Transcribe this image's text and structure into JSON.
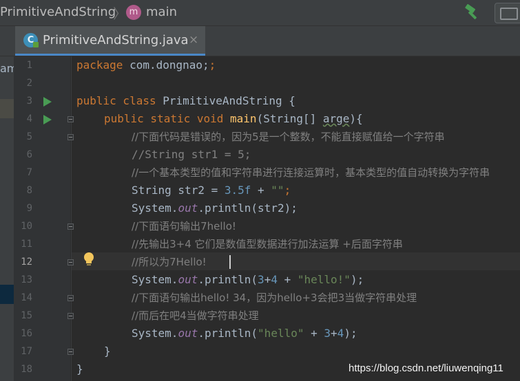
{
  "navbar": {
    "class_crumb": "PrimitiveAndString",
    "separator": "〉",
    "method_icon_letter": "m",
    "method_crumb": "main"
  },
  "tab": {
    "icon_letter": "C",
    "label": "PrimitiveAndString.java",
    "close": "×"
  },
  "sidebar": {
    "partial_text": "am"
  },
  "editor": {
    "current_line": 12,
    "line_numbers": [
      "1",
      "2",
      "3",
      "4",
      "5",
      "6",
      "7",
      "8",
      "9",
      "10",
      "11",
      "12",
      "13",
      "14",
      "15",
      "16",
      "17",
      "18"
    ],
    "lines": [
      {
        "a": "package",
        "b": " com.dongnao;"
      },
      {},
      {
        "a": "public class",
        "b": " PrimitiveAndString {"
      },
      {
        "a": "public static void",
        "b": " ",
        "c": "main",
        "d": "(String[] ",
        "e": "arge",
        "f": "){"
      },
      {
        "a": "//下面代码是错误的，因为5是一个整数，不能直接赋值给一个字符串"
      },
      {
        "a": "//String str1 = 5;"
      },
      {
        "a": "//一个基本类型的值和字符串进行连接运算时，基本类型的值自动转换为字符串"
      },
      {
        "a": "String str2 = ",
        "b": "3.5f",
        "c": " + ",
        "d": "\"\"",
        "e": ";"
      },
      {
        "a": "System.",
        "b": "out",
        "c": ".println(str2);"
      },
      {
        "a": "//下面语句输出7hello!"
      },
      {
        "a": "//先输出3+4 它们是数值型数据进行加法运算 +后面字符串"
      },
      {
        "a": "//所以为7Hello!"
      },
      {
        "a": "System.",
        "b": "out",
        "c": ".println(",
        "d": "3",
        "e": "+",
        "f": "4",
        "g": " + ",
        "h": "\"hello!\"",
        "i": ");"
      },
      {
        "a": "//下面语句输出hello! 34，因为hello+3会把3当做字符串处理"
      },
      {
        "a": "//而后在吧4当做字符串处理"
      },
      {
        "a": "System.",
        "b": "out",
        "c": ".println(",
        "d": "\"hello\"",
        "e": " + ",
        "f": "3",
        "g": "+",
        "h": "4",
        "i": ");"
      },
      {
        "a": "}"
      },
      {
        "a": "}"
      }
    ]
  },
  "watermark": "https://blog.csdn.net/liuwenqing11",
  "colors": {
    "keyword": "#cc7832",
    "method_name": "#ffc66d",
    "number": "#6897bb",
    "string": "#6a8759",
    "static_field": "#9876aa",
    "comment": "#808080",
    "default_text": "#a9b7c6",
    "background": "#2b2b2b"
  },
  "icons": {
    "build": "hammer-icon",
    "run": "run-gutter-icon",
    "intention": "lightbulb-icon",
    "fold": "fold-icon"
  }
}
